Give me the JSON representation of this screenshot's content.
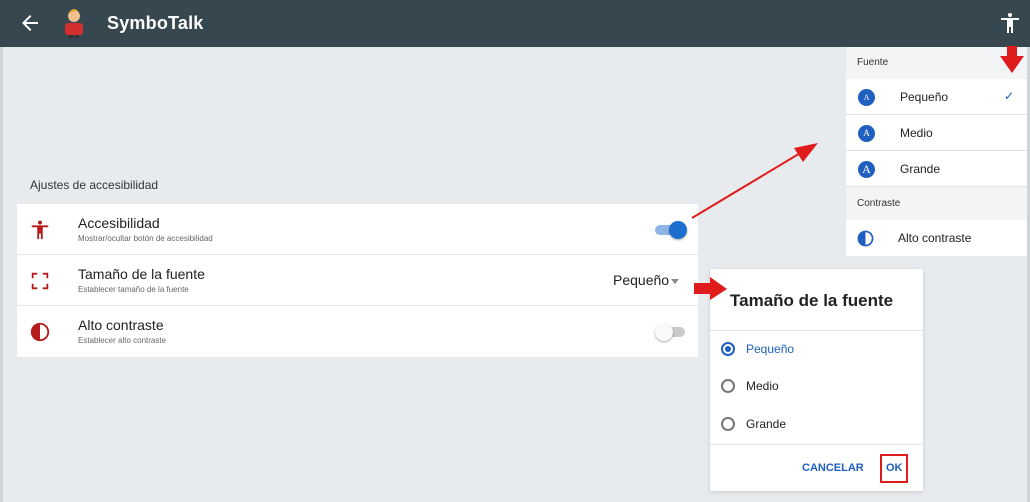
{
  "appbar": {
    "title": "SymboTalk",
    "back_icon": "arrow-left-icon",
    "logo_icon": "boy-avatar-icon",
    "accessibility_icon": "accessibility-icon",
    "background": "#37474f"
  },
  "settings": {
    "section_title": "Ajustes de accesibilidad",
    "rows": [
      {
        "label": "Accesibilidad",
        "sublabel": "Mostrar/ocultar botón de accesibilidad",
        "icon": "accessibility-icon",
        "control": "toggle",
        "on": true
      },
      {
        "label": "Tamaño de la fuente",
        "sublabel": "Establecer tamaño de la fuente",
        "icon": "font-size-icon",
        "control": "dropdown",
        "value": "Pequeño"
      },
      {
        "label": "Alto contraste",
        "sublabel": "Establecer alto contraste",
        "icon": "contrast-icon",
        "control": "toggle",
        "on": false
      }
    ]
  },
  "menu": {
    "font_header": "Fuente",
    "font_items": [
      {
        "label": "Pequeño",
        "glyph": "A",
        "checked": true
      },
      {
        "label": "Medio",
        "glyph": "A",
        "checked": false
      },
      {
        "label": "Grande",
        "glyph": "A",
        "checked": false
      }
    ],
    "check_glyph": "✓",
    "contrast_header": "Contraste",
    "contrast_item": "Alto contraste"
  },
  "dialog": {
    "title": "Tamaño de la fuente",
    "options": [
      "Pequeño",
      "Medio",
      "Grande"
    ],
    "selected": "Pequeño",
    "cancel_label": "CANCELAR",
    "ok_label": "OK"
  },
  "colors": {
    "accent": "#1f5fbf",
    "icon_red": "#b71c1c",
    "annotation_red": "#e01b1b"
  }
}
